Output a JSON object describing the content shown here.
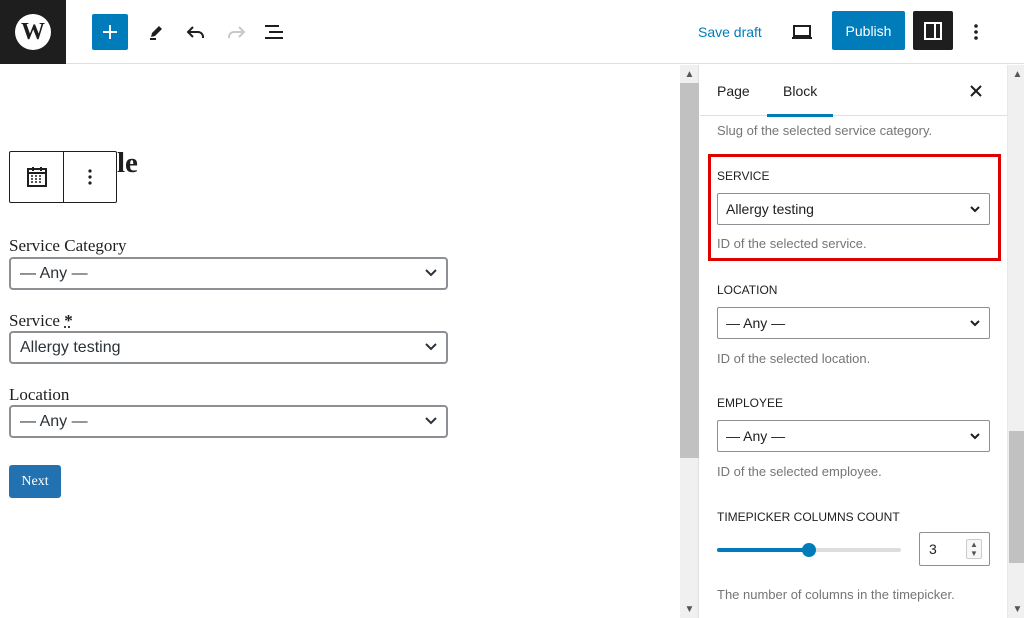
{
  "header": {
    "logo_glyph": "W",
    "save_draft_label": "Save draft",
    "publish_label": "Publish",
    "icons": [
      "add-block-icon",
      "pencil-icon",
      "undo-icon",
      "redo-icon",
      "list-view-icon",
      "desktop-preview-icon",
      "settings-panel-icon",
      "more-vertical-icon"
    ]
  },
  "editor": {
    "heading_fragment": "le",
    "fields": [
      {
        "label": "Service Category",
        "value": "— Any —"
      },
      {
        "label": "Service",
        "required_mark": "*",
        "value": "Allergy testing"
      },
      {
        "label": "Location",
        "value": "— Any —"
      }
    ],
    "next_label": "Next"
  },
  "sidebar": {
    "tabs": [
      "Page",
      "Block"
    ],
    "active_tab": "Block",
    "top_help": "Slug of the selected service category.",
    "service": {
      "label": "SERVICE",
      "value": "Allergy testing",
      "help": "ID of the selected service."
    },
    "location": {
      "label": "LOCATION",
      "value": "— Any —",
      "help": "ID of the selected location."
    },
    "employee": {
      "label": "EMPLOYEE",
      "value": "— Any —",
      "help": "ID of the selected employee."
    },
    "timepicker": {
      "label": "TIMEPICKER COLUMNS COUNT",
      "value": "3",
      "slider_fraction": 0.5,
      "help": "The number of columns in the timepicker."
    },
    "highlight_color": "#e00000",
    "accent_color": "#007cba"
  }
}
